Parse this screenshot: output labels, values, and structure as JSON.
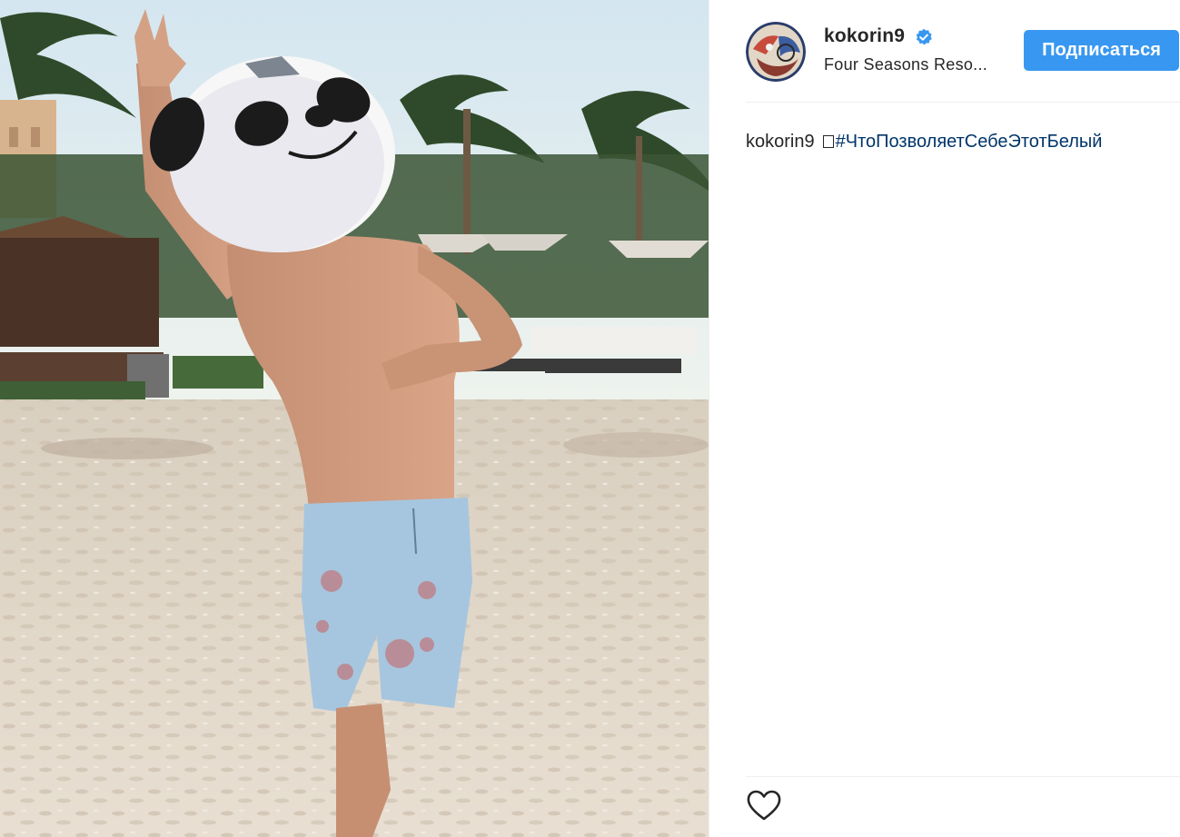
{
  "post": {
    "username": "kokorin9",
    "verified": true,
    "location": "Four Seasons Reso...",
    "follow_label": "Подписаться",
    "caption": {
      "username": "kokorin9",
      "hashtag": "#ЧтоПозволяетСебеЭтотБелый"
    }
  },
  "icons": {
    "verified": "verified-badge-icon",
    "like": "heart-outline-icon"
  },
  "colors": {
    "follow_button": "#3897f0",
    "verified_badge": "#3897f0",
    "hashtag": "#003569",
    "text": "#262626"
  }
}
